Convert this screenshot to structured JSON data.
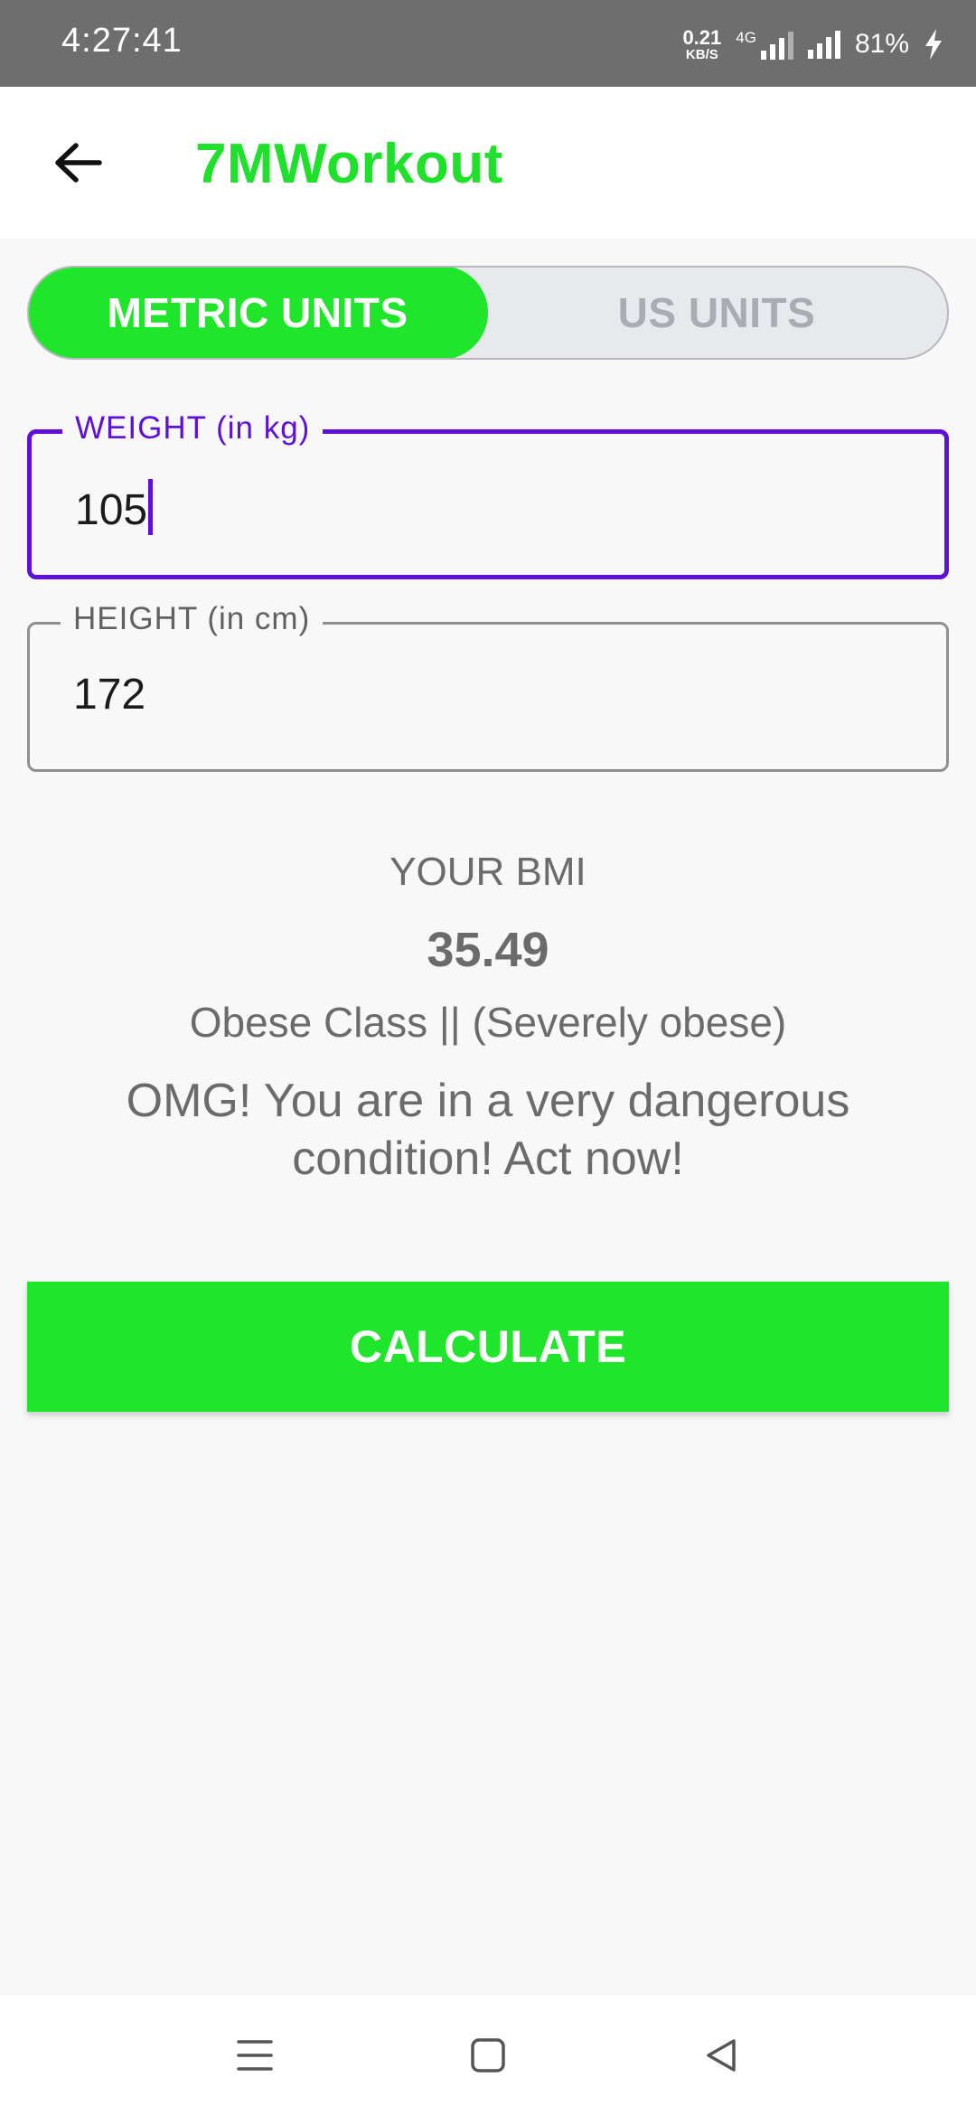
{
  "status_bar": {
    "time": "4:27:41",
    "net_speed_value": "0.21",
    "net_speed_unit": "KB/S",
    "network_type": "4G",
    "battery": "81%"
  },
  "app_bar": {
    "title": "7MWorkout",
    "title_color": "#1fe02a",
    "back_icon": "arrow-left-icon"
  },
  "units_toggle": {
    "options": [
      "METRIC UNITS",
      "US UNITS"
    ],
    "selected": "METRIC UNITS",
    "active_color": "#1fe62a"
  },
  "form": {
    "weight": {
      "label": "WEIGHT (in kg)",
      "value": "105",
      "focused": true
    },
    "height": {
      "label": "HEIGHT (in cm)",
      "value": "172"
    }
  },
  "result": {
    "label": "YOUR BMI",
    "value": "35.49",
    "type": "Obese Class || (Severely obese)",
    "description": "OMG! You are in a very dangerous condition! Act now!"
  },
  "calculate_button": {
    "label": "CALCULATE"
  },
  "nav_bar": {
    "icons": [
      "menu-icon",
      "home-square-icon",
      "back-triangle-icon"
    ]
  }
}
